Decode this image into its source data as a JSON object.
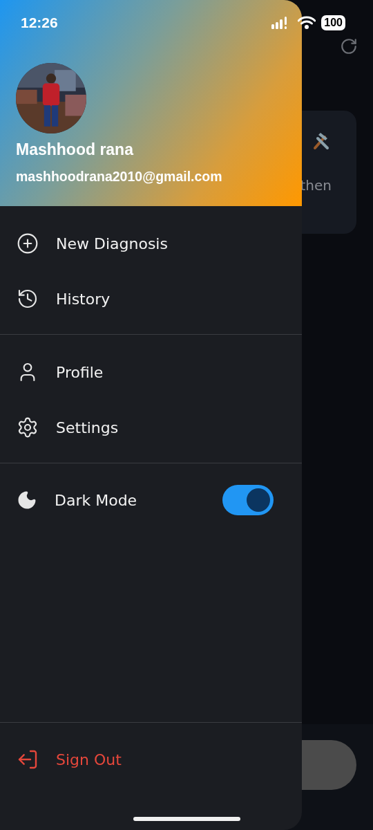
{
  "status_bar": {
    "time": "12:26",
    "battery": "100"
  },
  "background": {
    "card_text": "then"
  },
  "profile": {
    "name": "Mashhood rana",
    "email": "mashhoodrana2010@gmail.com"
  },
  "menu_sections": [
    {
      "items": [
        {
          "kind": "new",
          "label": "New Diagnosis"
        },
        {
          "kind": "history",
          "label": "History"
        }
      ]
    },
    {
      "items": [
        {
          "kind": "profile",
          "label": "Profile"
        },
        {
          "kind": "settings",
          "label": "Settings"
        }
      ]
    }
  ],
  "dark_mode": {
    "label": "Dark Mode",
    "on": true
  },
  "sign_out": {
    "label": "Sign Out"
  }
}
